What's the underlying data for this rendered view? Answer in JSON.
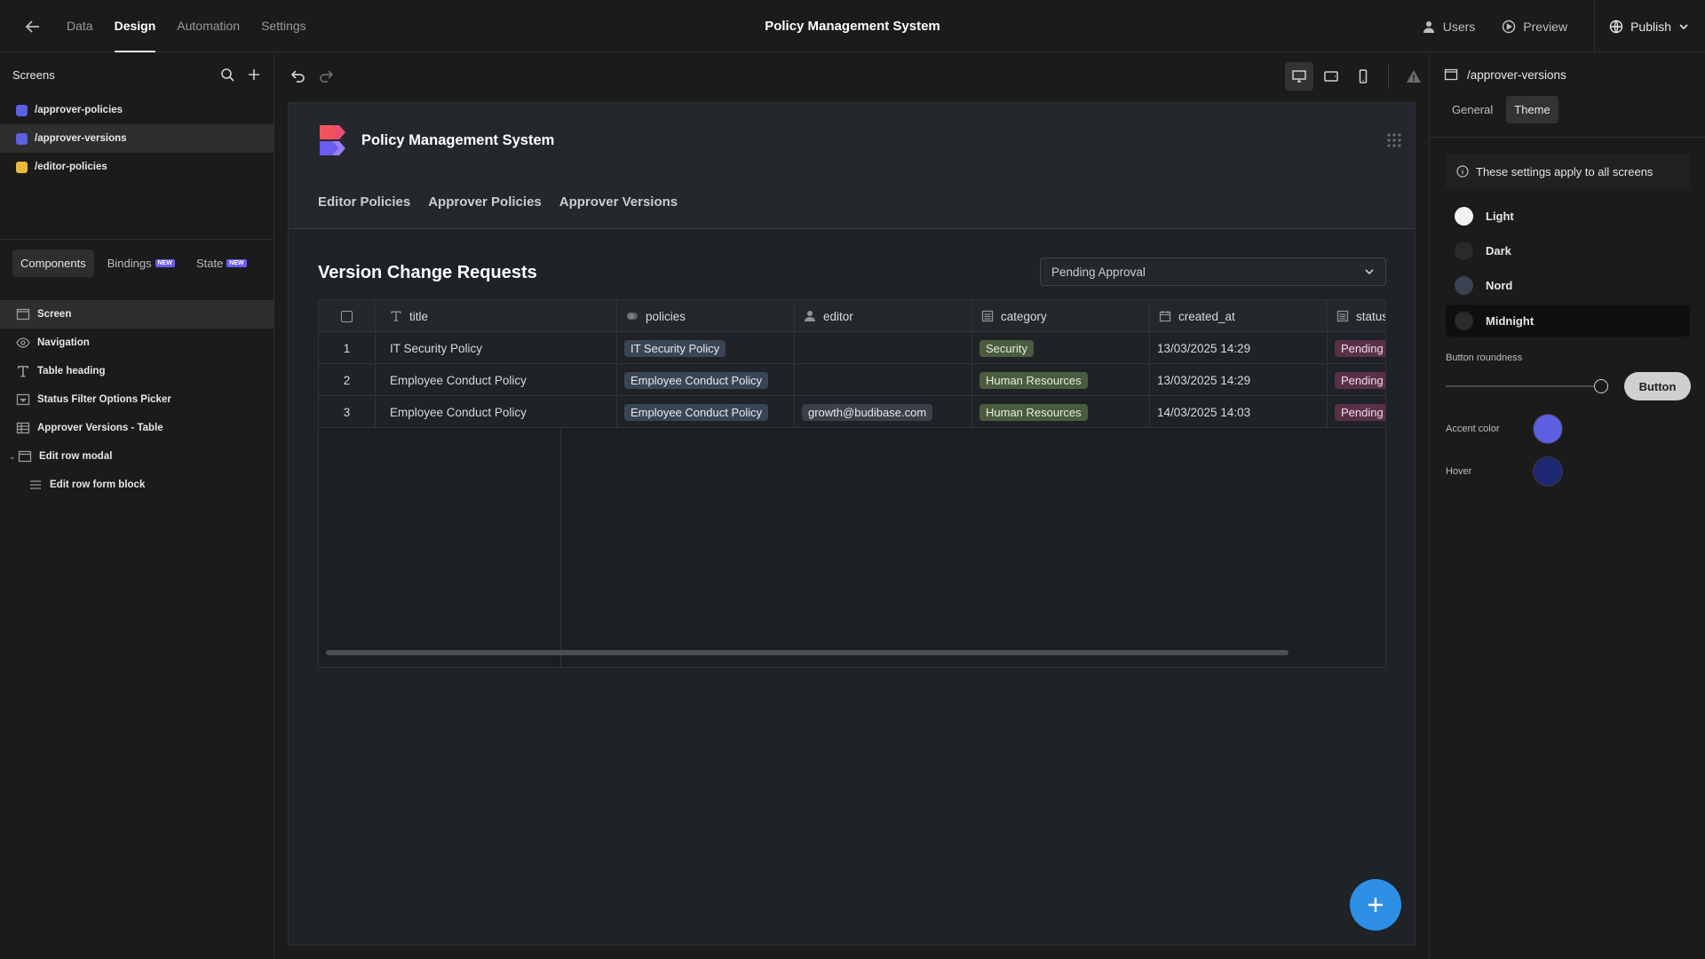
{
  "topbar": {
    "nav": [
      "Data",
      "Design",
      "Automation",
      "Settings"
    ],
    "active": "Design",
    "title": "Policy Management System",
    "users": "Users",
    "preview": "Preview",
    "publish": "Publish"
  },
  "left": {
    "screens_label": "Screens",
    "screens": [
      {
        "path": "/approver-policies",
        "color": "#5b5fe0"
      },
      {
        "path": "/approver-versions",
        "color": "#5b5fe0"
      },
      {
        "path": "/editor-policies",
        "color": "#e8b93a"
      }
    ],
    "tabs": {
      "components": "Components",
      "bindings": "Bindings",
      "state": "State",
      "new_badge": "NEW"
    },
    "components": [
      {
        "label": "Screen",
        "icon": "screen-icon"
      },
      {
        "label": "Navigation",
        "icon": "eye-icon"
      },
      {
        "label": "Table heading",
        "icon": "text-icon"
      },
      {
        "label": "Status Filter Options Picker",
        "icon": "select-icon"
      },
      {
        "label": "Approver Versions - Table",
        "icon": "table-icon"
      },
      {
        "label": "Edit row modal",
        "icon": "modal-icon"
      },
      {
        "label": "Edit row form block",
        "icon": "form-icon"
      }
    ]
  },
  "canvas": {
    "app_name": "Policy Management System",
    "nav": [
      "Editor Policies",
      "Approver Policies",
      "Approver Versions"
    ],
    "section_title": "Version Change Requests",
    "status_filter": "Pending Approval",
    "columns": [
      "title",
      "policies",
      "editor",
      "category",
      "created_at",
      "status"
    ],
    "rows": [
      {
        "n": "1",
        "title": "IT Security Policy",
        "policies": "IT Security Policy",
        "editor": "",
        "category": "Security",
        "created_at": "13/03/2025 14:29",
        "status": "Pending Approval"
      },
      {
        "n": "2",
        "title": "Employee Conduct Policy",
        "policies": "Employee Conduct Policy",
        "editor": "",
        "category": "Human Resources",
        "created_at": "13/03/2025 14:29",
        "status": "Pending Approval"
      },
      {
        "n": "3",
        "title": "Employee Conduct Policy",
        "policies": "Employee Conduct Policy",
        "editor": "growth@budibase.com",
        "category": "Human Resources",
        "created_at": "14/03/2025 14:03",
        "status": "Pending Approval"
      }
    ]
  },
  "right": {
    "screen_path": "/approver-versions",
    "tabs": [
      "General",
      "Theme"
    ],
    "active_tab": "Theme",
    "info": "These settings apply to all screens",
    "themes": [
      {
        "label": "Light",
        "color": "#f2f2f2"
      },
      {
        "label": "Dark",
        "color": "#2a2a2a"
      },
      {
        "label": "Nord",
        "color": "#3b4252"
      },
      {
        "label": "Midnight",
        "color": "#2b2b2b"
      }
    ],
    "selected_theme": "Midnight",
    "button_roundness_label": "Button roundness",
    "button_label": "Button",
    "accent_label": "Accent color",
    "accent_color": "#5b5fe0",
    "hover_label": "Hover",
    "hover_color": "#1e2873"
  }
}
